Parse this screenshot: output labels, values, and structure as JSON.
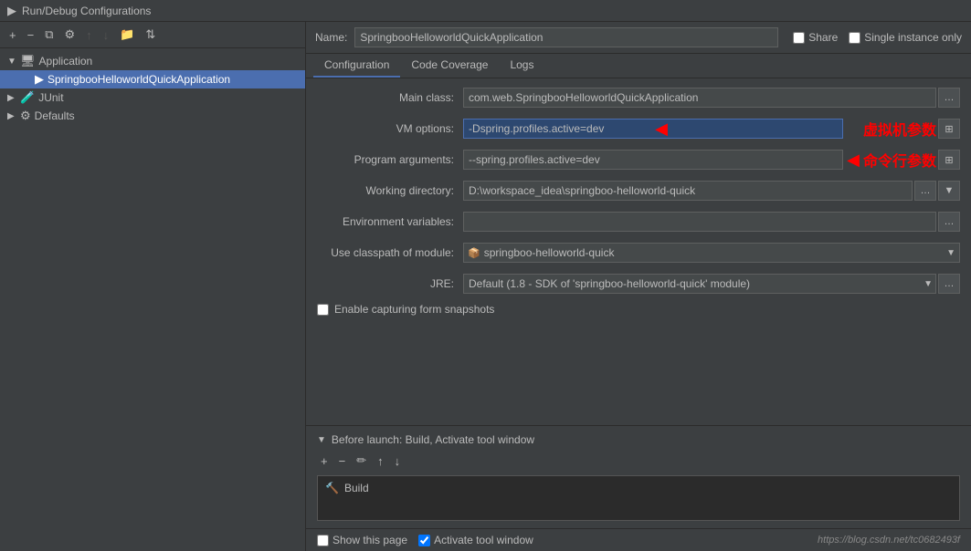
{
  "titleBar": {
    "icon": "▶",
    "title": "Run/Debug Configurations"
  },
  "leftPanel": {
    "toolbar": {
      "add": "+",
      "remove": "−",
      "copy": "⧉",
      "settings": "⚙",
      "moveUp": "↑",
      "moveDown": "↓",
      "folder": "📁",
      "sort": "⇅"
    },
    "tree": {
      "items": [
        {
          "label": "Application",
          "level": 0,
          "type": "group",
          "expanded": true,
          "icon": "🖥"
        },
        {
          "label": "SpringbooHelloworldQuickApplication",
          "level": 1,
          "type": "app",
          "selected": true,
          "icon": "▶"
        },
        {
          "label": "JUnit",
          "level": 0,
          "type": "group",
          "expanded": false,
          "icon": "🧪"
        },
        {
          "label": "Defaults",
          "level": 0,
          "type": "group",
          "expanded": false,
          "icon": "⚙"
        }
      ]
    }
  },
  "rightPanel": {
    "nameLabel": "Name:",
    "nameValue": "SpringbooHelloworldQuickApplication",
    "shareLabel": "Share",
    "singleInstanceLabel": "Single instance only",
    "tabs": [
      {
        "label": "Configuration",
        "active": true
      },
      {
        "label": "Code Coverage",
        "active": false
      },
      {
        "label": "Logs",
        "active": false
      }
    ],
    "form": {
      "mainClassLabel": "Main class:",
      "mainClassValue": "com.web.SpringbooHelloworldQuickApplication",
      "vmOptionsLabel": "VM options:",
      "vmOptionsValue": "-Dspring.profiles.active=dev",
      "vmOptionsAnnotation": "虚拟机参数",
      "programArgsLabel": "Program arguments:",
      "programArgsValue": "--spring.profiles.active=dev",
      "programArgsAnnotation": "命令行参数",
      "workingDirLabel": "Working directory:",
      "workingDirValue": "D:\\workspace_idea\\springboo-helloworld-quick",
      "envVarsLabel": "Environment variables:",
      "envVarsValue": "",
      "classpathLabel": "Use classpath of module:",
      "classpathValue": "springboo-helloworld-quick",
      "jreLabel": "JRE:",
      "jreValue": "Default (1.8 - SDK of 'springboo-helloworld-quick' module)",
      "enableCaptureLabel": "Enable capturing form snapshots"
    },
    "beforeLaunch": {
      "headerLabel": "Before launch: Build, Activate tool window",
      "items": [
        {
          "label": "Build",
          "icon": "🔨"
        }
      ]
    },
    "bottomBar": {
      "showPageLabel": "Show this page",
      "activateLabel": "Activate tool window",
      "watermark": "https://blog.csdn.net/tc0682493f"
    }
  }
}
